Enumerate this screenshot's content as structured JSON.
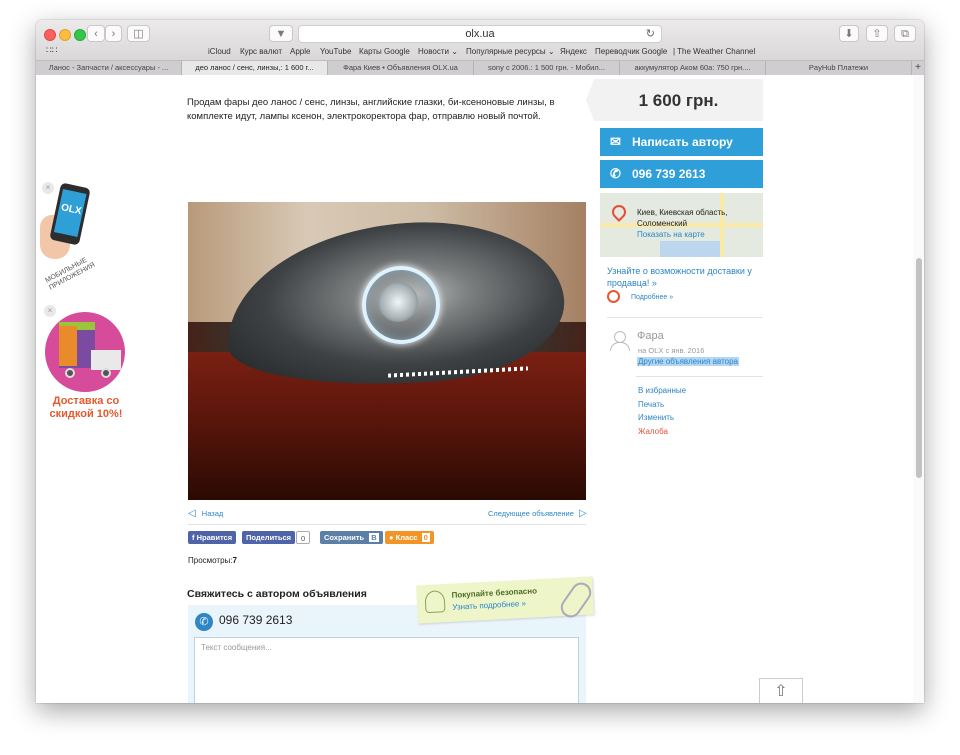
{
  "browser": {
    "url": "olx.ua",
    "favorites": [
      "iCloud",
      "Курс валют",
      "Apple",
      "YouTube",
      "Карты Google",
      "Новости ⌄",
      "Популярные ресурсы ⌄",
      "Яндекс",
      "Переводчик Google",
      "| The Weather Channel"
    ],
    "tabs": [
      {
        "label": "Ланос - Запчасти / аксессуары - ..."
      },
      {
        "label": "део ланос / сенс, линзы,: 1 600 г..."
      },
      {
        "label": "Фара Киев • Объявления OLX.ua"
      },
      {
        "label": "sony с 2006.: 1 500 грн. - Мобил..."
      },
      {
        "label": "аккумулятор Аком 60а: 750 грн...."
      },
      {
        "label": "PayHub Платежи"
      }
    ],
    "new_tab": "+"
  },
  "listing": {
    "description": "Продам фары део ланос / сенс, линзы, английские глазки, би-ксеноновые линзы, в комплекте идут, лампы ксенон, электрокоректора фар, отправлю новый почтой.",
    "price": "1 600 грн.",
    "write_author": "Написать автору",
    "phone": "096 739 2613",
    "location": "Киев, Киевская область, Соломенский",
    "show_on_map": "Показать на карте",
    "delivery_text": "Узнайте о возможности доставки у продавца! »",
    "delivery_more": "Подробнее »",
    "user_name": "Фара",
    "user_since": "на OLX с янв. 2016",
    "other_ads": "Другие объявления автора",
    "actions": [
      "В избранные",
      "Печать",
      "Изменить",
      "Жалоба"
    ],
    "nav_back": "Назад",
    "nav_next": "Следующее объявление",
    "social": {
      "like": "Нравится",
      "share": "Поделиться",
      "share_count": "0",
      "save": "Сохранить",
      "vk": "В",
      "class": "Класс",
      "class_count": "0"
    },
    "views_label": "Просмотры:",
    "views_count": "7",
    "contact_heading": "Свяжитесь с автором объявления",
    "contact_phone": "096 739 2613",
    "message_placeholder": "Текст сообщения...",
    "safe_title": "Покупайте безопасно",
    "safe_link": "Узнать подробнее »"
  },
  "ads": {
    "app_text": "Мобильные приложения",
    "app_logo": "OLX",
    "promo": "Доставка со скидкой 10%!",
    "close": "×"
  },
  "colors": {
    "accent": "#2e9fd8",
    "link": "#2b86c5",
    "promo": "#e55a2d"
  }
}
